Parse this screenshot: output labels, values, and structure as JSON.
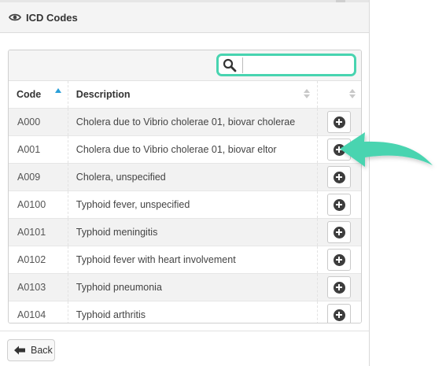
{
  "header": {
    "title": "ICD Codes",
    "icon": "eye-icon"
  },
  "search": {
    "placeholder": "",
    "value": ""
  },
  "table": {
    "columns": [
      "Code",
      "Description",
      ""
    ],
    "sort": {
      "column": "Code",
      "direction": "ascending"
    },
    "rows": [
      {
        "code": "A000",
        "description": "Cholera due to Vibrio cholerae 01, biovar cholerae"
      },
      {
        "code": "A001",
        "description": "Cholera due to Vibrio cholerae 01, biovar eltor"
      },
      {
        "code": "A009",
        "description": "Cholera, unspecified"
      },
      {
        "code": "A0100",
        "description": "Typhoid fever, unspecified"
      },
      {
        "code": "A0101",
        "description": "Typhoid meningitis"
      },
      {
        "code": "A0102",
        "description": "Typhoid fever with heart involvement"
      },
      {
        "code": "A0103",
        "description": "Typhoid pneumonia"
      },
      {
        "code": "A0104",
        "description": "Typhoid arthritis"
      }
    ]
  },
  "footer": {
    "back_label": "Back"
  },
  "colors": {
    "accent": "#48d4b0",
    "sort_active": "#2a9fd8",
    "add_icon": "#3d3d3d"
  }
}
